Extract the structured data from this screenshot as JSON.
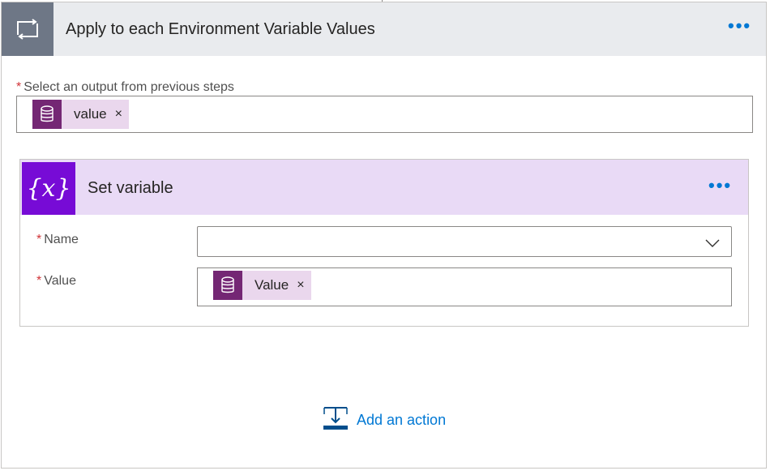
{
  "loop": {
    "title": "Apply to each Environment Variable Values",
    "more_label": "•••",
    "select_label": "Select an output from previous steps",
    "select_required": "*",
    "token_label": "value",
    "token_remove": "×"
  },
  "action": {
    "title": "Set variable",
    "icon_text": "{x}",
    "more_label": "•••",
    "name_label": "Name",
    "name_required": "*",
    "name_value": "",
    "value_label": "Value",
    "value_required": "*",
    "value_token_label": "Value",
    "value_token_remove": "×"
  },
  "footer": {
    "add_action_label": "Add an action"
  },
  "icons": {
    "loop": "loop-arrows-icon",
    "database": "database-icon",
    "variable": "variable-icon",
    "chevron": "chevron-down-icon",
    "add_action": "insert-step-icon"
  },
  "colors": {
    "accent": "#0078d4",
    "loop_icon_bg": "#6e7786",
    "variable_icon_bg": "#770bd6",
    "token_bg": "#ead7ed",
    "token_icon_bg": "#742774",
    "required": "#d13438"
  }
}
